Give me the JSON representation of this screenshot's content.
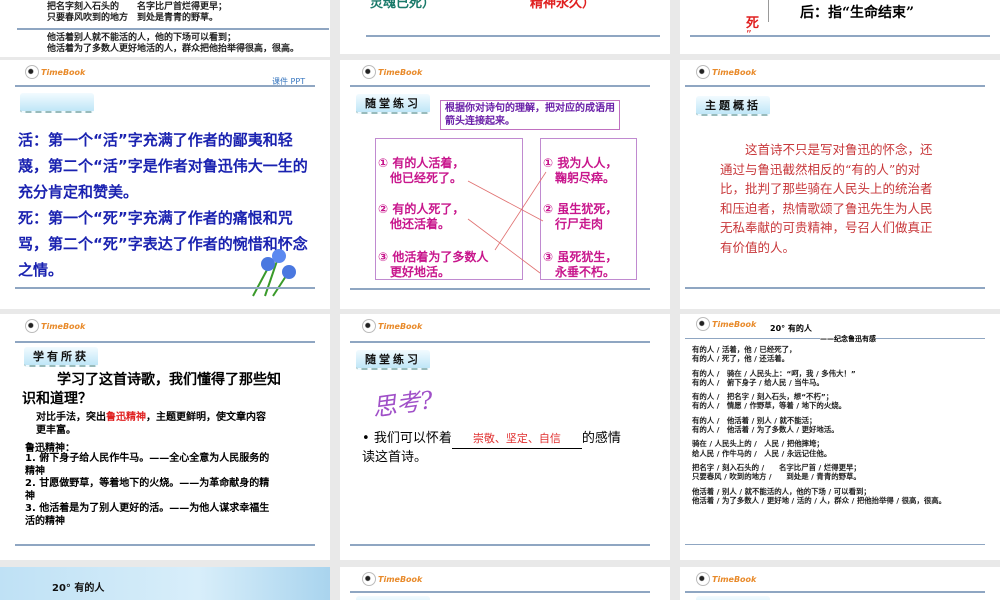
{
  "row0": {
    "s1": {
      "lines": [
        "把名字刻入石头的　　名字比尸首烂得更早；",
        "只要春风吹到的地方　到处是青青的野草。",
        "他活着别人就不能活的人，他的下场可以看到；",
        "他活着为了多数人更好地活的人，群众把他抬举得很高，很高。"
      ]
    },
    "s2": {
      "left": "灵魂已死）",
      "right": "精神永久）"
    },
    "s3": {
      "die": "死",
      "quote": "”",
      "text": "后：指“生命结束”"
    }
  },
  "logo_text": "TimeBook",
  "slide_a": {
    "corner": "课件 PPT",
    "paragraphs": [
      "活：第一个“活”字充满了作者的鄙夷和轻蔑，第二个“活”字是作者对鲁迅伟大一生的充分肯定和赞美。",
      "死：第一个“死”字充满了作者的痛恨和咒骂，第二个“死”字表达了作者的惋惜和怀念之情。"
    ]
  },
  "slide_b": {
    "tab": "随堂练习",
    "instruction": "根据你对诗句的理解，把对应的成语用箭头连接起来。",
    "left": [
      "① 有的人活着，\n　他已经死了。",
      "② 有的人死了，\n　他还活着。",
      "③ 他活着为了多数人\n　更好地活。"
    ],
    "right": [
      "① 我为人人，\n　鞠躬尽瘁。",
      "② 虽生犹死，\n　行尸走肉",
      "③ 虽死犹生，\n　永垂不朽。"
    ]
  },
  "slide_c": {
    "tab": "主题概括",
    "text": "这首诗不只是写对鲁迅的怀念，还通过与鲁迅截然相反的“有的人”的对比，批判了那些骑在人民头上的统治者和压迫者，热情歌颂了鲁迅先生为人民无私奉献的可贵精神，号召人们做真正有价值的人。"
  },
  "slide_d": {
    "tab": "学有所获",
    "question": "学习了这首诗歌，我们懂得了那些知识和道理？",
    "contrast_a": "对比手法，突出",
    "contrast_red": "鲁迅精神",
    "contrast_b": "，主题更鲜明，使文章内容更丰富。",
    "label": "鲁迅精神：",
    "items": [
      "1. 俯下身子给人民作牛马。——全心全意为人民服务的精神",
      "2. 甘愿做野草，等着地下的火烧。——为革命献身的精神",
      "3. 他活着是为了别人更好的活。——为他人谋求幸福生活的精神"
    ]
  },
  "slide_e": {
    "tab": "随堂练习",
    "think": "思考?",
    "before": "我们可以怀着",
    "answer": "崇敬、坚定、自信",
    "after": "的感情读这首诗。"
  },
  "slide_f": {
    "title": "20° 有的人",
    "subtitle": "——纪念鲁迅有感",
    "lines": [
      "有的人 / 活着，他 / 已经死了，",
      "有的人 / 死了，他 / 还活着。",
      "",
      "有的人 /　骑在 / 人民头上：“呵，我 / 多伟大！”",
      "有的人 /　俯下身子 / 给人民 / 当牛马。",
      "",
      "有的人 /　把名字 / 刻入石头，想“不朽”；",
      "有的人 /　情愿 / 作野草，等着 / 地下的火烧。",
      "",
      "有的人 /　他活着 / 别人 / 就不能活；",
      "有的人 /　他活着 / 为了多数人 / 更好地活。",
      "",
      "骑在 / 人民头上的 /　人民 / 把他摔垮；",
      "给人民 / 作牛马的 /　人民 / 永远记住他。",
      "",
      "把名字 / 刻入石头的 /　　名字比尸首 / 烂得更早；",
      "只要春风 / 吹到的地方 /　　到处是 / 青青的野草。",
      "",
      "他活着 / 别人 / 就不能活的人，他的下场 / 可以看到；",
      "他活着 / 为了多数人 / 更好地 / 活的 / 人，群众 / 把他抬举得 / 很高，很高。"
    ]
  },
  "row4": {
    "title": "20° 有的人"
  }
}
